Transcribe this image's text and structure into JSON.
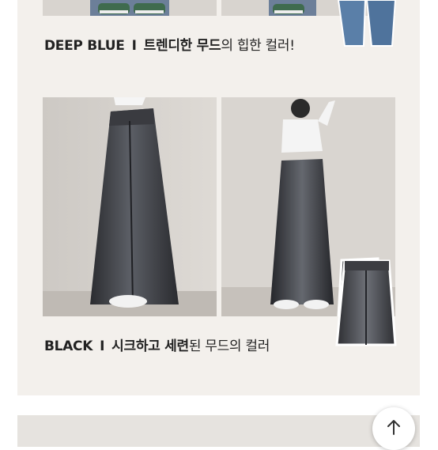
{
  "sections": [
    {
      "color_name": "DEEP BLUE",
      "separator": "I",
      "highlight": "트렌디한 무드",
      "rest": "의 힙한 컬러!"
    },
    {
      "color_name": "BLACK",
      "separator": "I",
      "highlight": "시크하고 세련",
      "rest": "된 무드의 컬러"
    }
  ],
  "scroll_top": {
    "icon": "arrow-up-icon"
  },
  "colors": {
    "card_bg": "#f3f0ec",
    "text": "#222222",
    "bottom_card_bg": "#e6e3df"
  }
}
